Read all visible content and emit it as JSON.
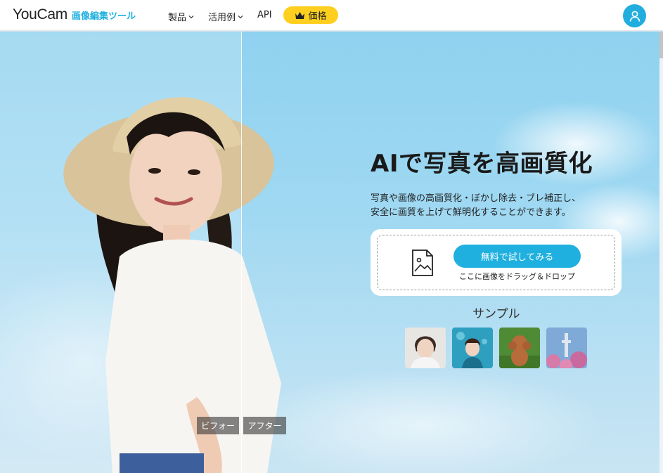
{
  "nav": {
    "logo_main": "YouCam",
    "logo_sub": "画像編集ツール",
    "items": [
      {
        "label": "製品",
        "has_dropdown": true
      },
      {
        "label": "活用例",
        "has_dropdown": true
      },
      {
        "label": "API",
        "has_dropdown": false
      }
    ],
    "price_label": "価格",
    "price_icon": "crown-icon",
    "account_icon": "user-icon"
  },
  "hero": {
    "title": "AIで写真を高画質化",
    "desc_line1": "写真や画像の高画質化・ぼかし除去・ブレ補正し、",
    "desc_line2": "安全に画質を上げて鮮明化することができます。",
    "try_button": "無料で試してみる",
    "drop_hint": "ここに画像をドラッグ＆ドロップ",
    "sample_label": "サンプル",
    "samples": [
      "sample-portrait-man",
      "sample-underwater-girl",
      "sample-poodle-dog",
      "sample-tower-flowers"
    ],
    "before_label": "ビフォー",
    "after_label": "アフター"
  },
  "colors": {
    "accent": "#1fb0df",
    "price_yellow": "#ffcf1f",
    "sky": "#9fd8f2"
  }
}
